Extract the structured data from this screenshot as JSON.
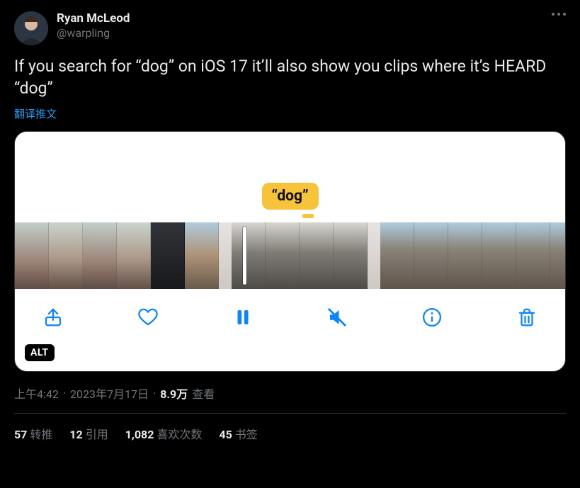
{
  "author": {
    "display_name": "Ryan McLeod",
    "handle": "@warpling"
  },
  "tweet_text": "If you search for “dog” on iOS 17 it’ll also show you clips where it’s HEARD “dog”",
  "translate_label": "翻译推文",
  "media": {
    "search_term": "“dog”",
    "alt_badge": "ALT",
    "toolbar": {
      "share": "share-icon",
      "like": "heart-icon",
      "pause": "pause-icon",
      "mute": "mute-icon",
      "info": "info-icon",
      "trash": "trash-icon"
    }
  },
  "timestamp": {
    "time": "上午4:42",
    "date": "2023年7月17日",
    "views_number": "8.9万",
    "views_label": "查看"
  },
  "stats": {
    "retweets_count": "57",
    "retweets_label": "转推",
    "quotes_count": "12",
    "quotes_label": "引用",
    "likes_count": "1,082",
    "likes_label": "喜欢次数",
    "bookmarks_count": "45",
    "bookmarks_label": "书签"
  }
}
